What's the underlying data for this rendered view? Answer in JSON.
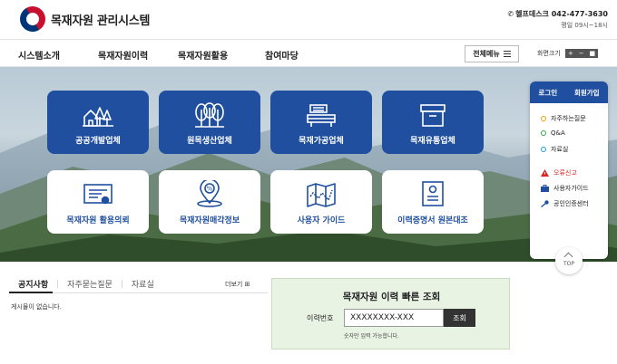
{
  "header": {
    "site_title": "목재자원 관리시스템",
    "helpdesk": "헬프데스크 042-477-3630",
    "hours": "평일 09시~18시"
  },
  "nav": {
    "items": [
      "시스템소개",
      "목재자원이력",
      "목재자원활용",
      "참여마당"
    ],
    "all_menu": "전체메뉴",
    "zoom_label": "화면크기",
    "zoom_plus": "+",
    "zoom_minus": "−"
  },
  "tiles": [
    {
      "label": "공공개발업체",
      "icon": "forest-house-icon",
      "style": "blue"
    },
    {
      "label": "원목생산업체",
      "icon": "trees-icon",
      "style": "blue"
    },
    {
      "label": "목재가공업체",
      "icon": "sawmill-icon",
      "style": "blue"
    },
    {
      "label": "목재유통업체",
      "icon": "box-icon",
      "style": "blue"
    },
    {
      "label": "목재자원 활용의뢰",
      "icon": "certificate-icon",
      "style": "white"
    },
    {
      "label": "목재자원매각정보",
      "icon": "location-percent-icon",
      "style": "white"
    },
    {
      "label": "사용자 가이드",
      "icon": "map-icon",
      "style": "white"
    },
    {
      "label": "이력증명서 원본대조",
      "icon": "document-icon",
      "style": "white"
    }
  ],
  "side": {
    "login": "로그인",
    "signup": "회원가입",
    "links": [
      {
        "label": "자주하는질문",
        "color": "#f2a100"
      },
      {
        "label": "Q&A",
        "color": "#2aa84a"
      },
      {
        "label": "자료실",
        "color": "#1a9bd7"
      }
    ],
    "links2": [
      {
        "label": "오류신고",
        "icon": "warning-icon"
      },
      {
        "label": "사용자가이드",
        "icon": "briefcase-icon"
      },
      {
        "label": "공인인증센터",
        "icon": "key-icon"
      }
    ],
    "top": "TOP"
  },
  "notice": {
    "tabs": [
      "공지사항",
      "자주묻는질문",
      "자료실"
    ],
    "more": "더보기",
    "empty": "게시물이 없습니다."
  },
  "quick": {
    "title": "목재자원 이력 빠른 조회",
    "label": "이력번호",
    "input_value": "XXXXXXXX-XXX",
    "button": "조회",
    "hint": "숫자만 입력 가능합니다."
  },
  "colors": {
    "primary": "#1f4f9e",
    "quick_bg": "#e9f3e4"
  }
}
